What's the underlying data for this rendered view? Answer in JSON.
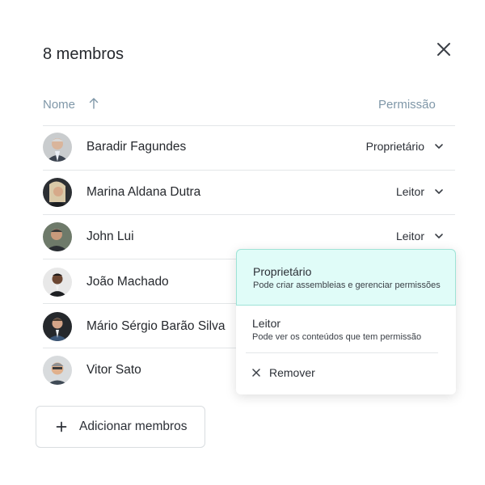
{
  "dialog": {
    "title": "8 membros"
  },
  "table": {
    "col_name": "Nome",
    "col_permission": "Permissão"
  },
  "members": [
    {
      "name": "Baradir Fagundes",
      "permission": "Proprietário"
    },
    {
      "name": "Marina Aldana Dutra",
      "permission": "Leitor"
    },
    {
      "name": "John Lui",
      "permission": "Leitor"
    },
    {
      "name": "João Machado",
      "permission": ""
    },
    {
      "name": "Mário Sérgio Barão Silva",
      "permission": ""
    },
    {
      "name": "Vitor Sato",
      "permission": ""
    }
  ],
  "dropdown": {
    "options": [
      {
        "title": "Proprietário",
        "description": "Pode criar assembleias e gerenciar permissões",
        "selected": true
      },
      {
        "title": "Leitor",
        "description": "Pode ver os conteúdos que tem permissão",
        "selected": false
      }
    ],
    "remove_label": "Remover"
  },
  "add_button": {
    "label": "Adicionar membros"
  },
  "icons": {
    "close": "close-icon",
    "sort": "arrow-up-icon",
    "chevron": "chevron-down-icon",
    "plus": "plus-icon",
    "remove": "x-icon"
  },
  "colors": {
    "accent_bg": "#e0fcf8",
    "accent_border": "#9ee3d6",
    "header_text": "#7f97a8",
    "divider": "#e3e6e8"
  }
}
